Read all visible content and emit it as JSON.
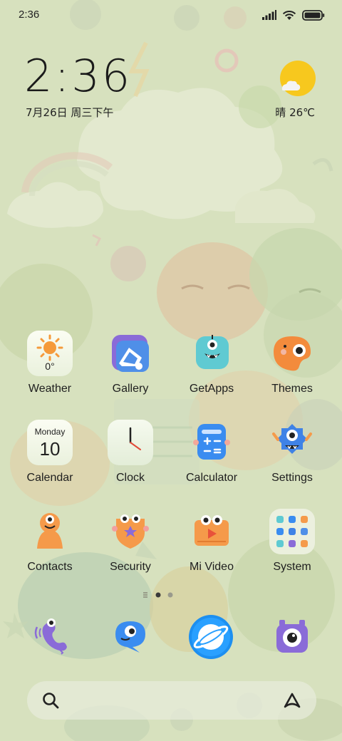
{
  "status_bar": {
    "time": "2:36",
    "icons": [
      "signal-icon",
      "wifi-icon",
      "battery-icon"
    ]
  },
  "clock_widget": {
    "time": "2:36",
    "date": "7月26日 周三下午"
  },
  "weather_widget": {
    "icon": "sunny-cloud-icon",
    "text": "晴 26℃"
  },
  "apps": [
    {
      "id": "weather",
      "label": "Weather",
      "icon_text": "0°"
    },
    {
      "id": "gallery",
      "label": "Gallery"
    },
    {
      "id": "getapps",
      "label": "GetApps"
    },
    {
      "id": "themes",
      "label": "Themes"
    },
    {
      "id": "calendar",
      "label": "Calendar",
      "icon_day": "Monday",
      "icon_date": "10"
    },
    {
      "id": "clock",
      "label": "Clock"
    },
    {
      "id": "calculator",
      "label": "Calculator"
    },
    {
      "id": "settings",
      "label": "Settings"
    },
    {
      "id": "contacts",
      "label": "Contacts"
    },
    {
      "id": "security",
      "label": "Security"
    },
    {
      "id": "mivideo",
      "label": "Mi Video"
    },
    {
      "id": "system",
      "label": "System"
    }
  ],
  "pager": {
    "pages": 2,
    "active": 1
  },
  "dock": [
    "phone-app-icon",
    "messages-app-icon",
    "browser-app-icon",
    "camera-app-icon"
  ],
  "search_bar": {
    "left_icon": "search-icon",
    "right_icon": "assistant-icon"
  },
  "colors": {
    "wallpaper": "#d6e0bd",
    "sun": "#f7c81e",
    "browser": "#1d8ff0",
    "purple": "#8a6bd8",
    "orange": "#f59a4a"
  }
}
